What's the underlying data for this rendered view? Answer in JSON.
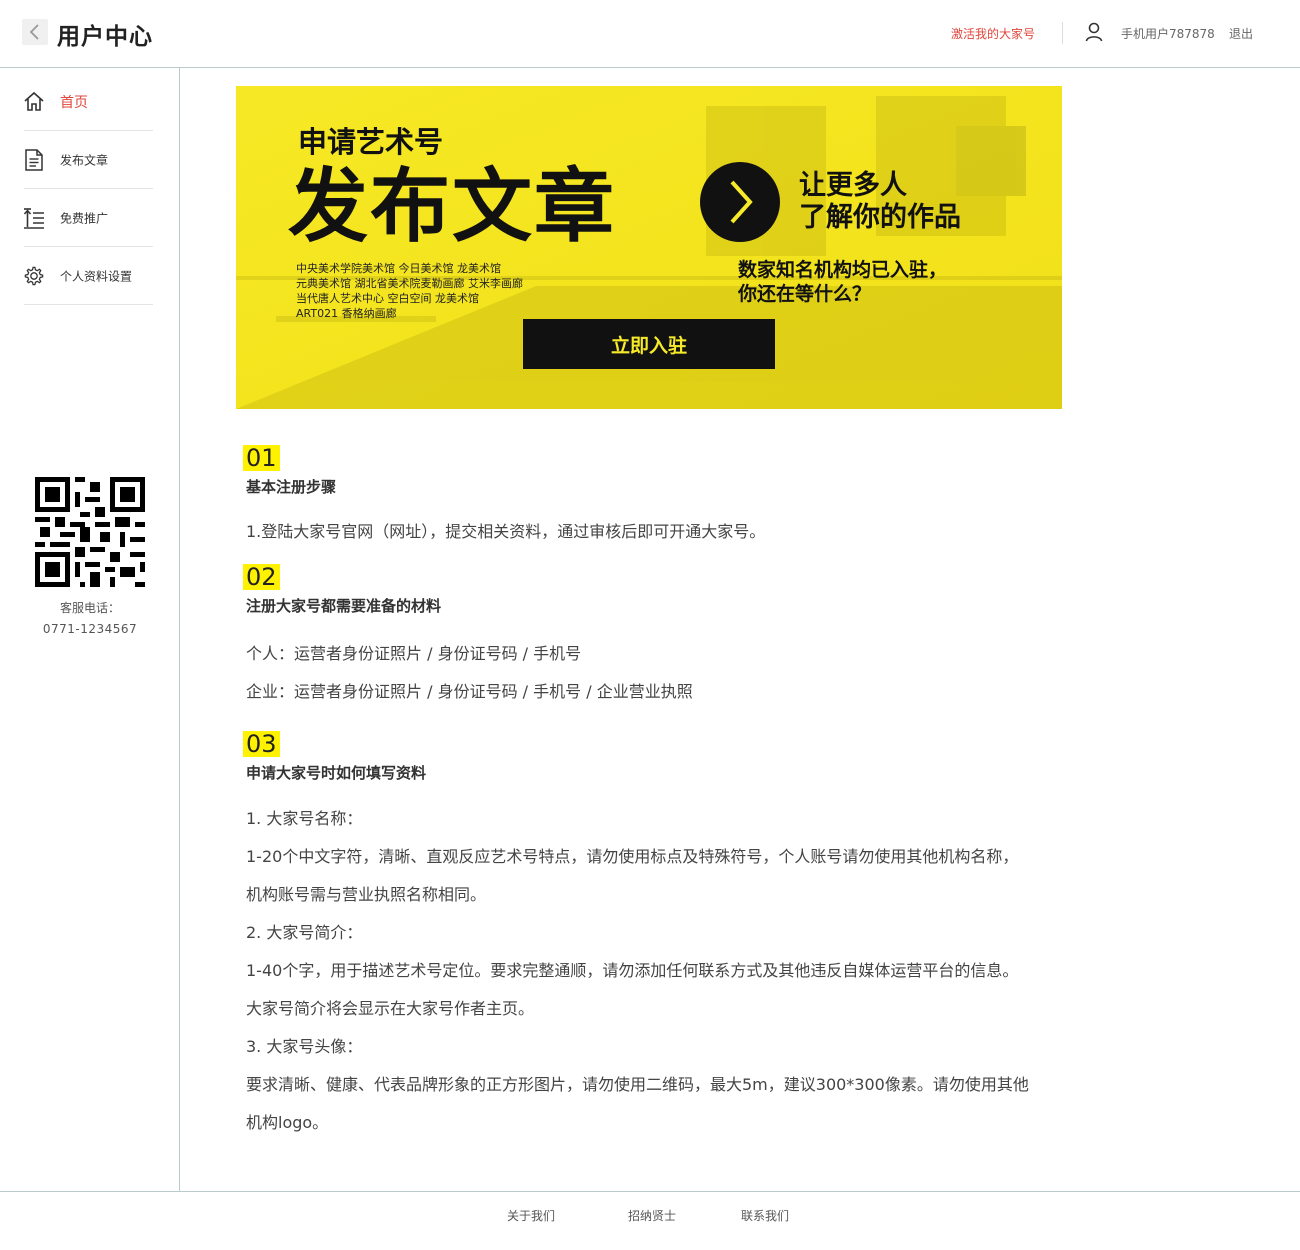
{
  "header": {
    "title": "用户中心",
    "activate_link": "激活我的大家号",
    "user_name": "手机用户787878",
    "logout": "退出"
  },
  "sidebar": {
    "items": [
      {
        "label": "首页",
        "icon": "home-icon",
        "active": true
      },
      {
        "label": "发布文章",
        "icon": "document-icon",
        "active": false
      },
      {
        "label": "免费推广",
        "icon": "promote-icon",
        "active": false
      },
      {
        "label": "个人资料设置",
        "icon": "gear-icon",
        "active": false
      }
    ],
    "service_label": "客服电话：",
    "service_phone": "0771-1234567"
  },
  "banner": {
    "line1": "申请艺术号",
    "headline": "发布文章",
    "slogan1": "让更多人",
    "slogan2": "了解你的作品",
    "institutions": [
      "中央美术学院美术馆  今日美术馆  龙美术馆",
      "元典美术馆  湖北省美术院麦勒画廊  艾米李画廊",
      "当代唐人艺术中心  空白空间  龙美术馆",
      "ART021  香格纳画廊"
    ],
    "tagline1": "数家知名机构均已入驻，",
    "tagline2": "你还在等什么？",
    "cta": "立即入驻",
    "colors": {
      "background": "#f5e61c",
      "accent": "#111111"
    }
  },
  "sections": [
    {
      "number": "01",
      "title": "基本注册步骤",
      "paragraphs": [
        "1.登陆大家号官网（网址），提交相关资料，通过审核后即可开通大家号。"
      ]
    },
    {
      "number": "02",
      "title": "注册大家号都需要准备的材料",
      "paragraphs": [
        "个人：运营者身份证照片 / 身份证号码 / 手机号",
        "企业：运营者身份证照片 / 身份证号码 / 手机号 / 企业营业执照"
      ]
    },
    {
      "number": "03",
      "title": "申请大家号时如何填写资料",
      "paragraphs": [
        "1. 大家号名称：",
        "1-20个中文字符，清晰、直观反应艺术号特点，请勿使用标点及特殊符号，个人账号请勿使用其他机构名称，",
        "机构账号需与营业执照名称相同。",
        "2. 大家号简介：",
        "1-40个字，用于描述艺术号定位。要求完整通顺，请勿添加任何联系方式及其他违反自媒体运营平台的信息。",
        "大家号简介将会显示在大家号作者主页。",
        "3. 大家号头像：",
        "要求清晰、健康、代表品牌形象的正方形图片，请勿使用二维码，最大5m，建议300*300像素。请勿使用其他",
        "机构logo。"
      ]
    }
  ],
  "footer": {
    "links": [
      "关于我们",
      "招纳贤士",
      "联系我们"
    ]
  },
  "colors": {
    "accent_red": "#e0463c",
    "highlight_yellow": "#fff200",
    "border": "#b9cbcb"
  }
}
